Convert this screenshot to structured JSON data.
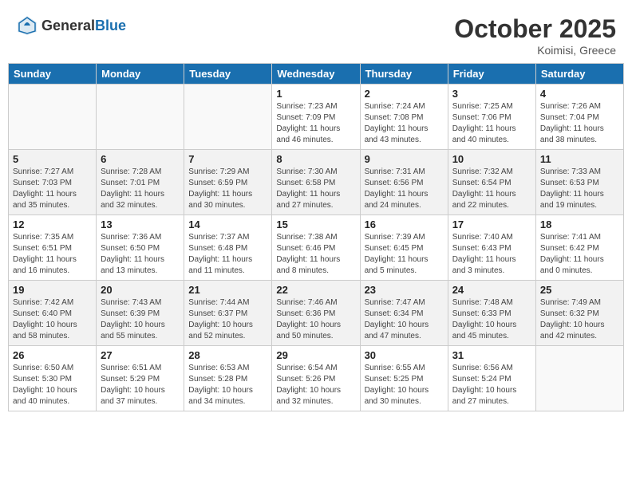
{
  "header": {
    "logo_general": "General",
    "logo_blue": "Blue",
    "month": "October 2025",
    "location": "Koimisi, Greece"
  },
  "weekdays": [
    "Sunday",
    "Monday",
    "Tuesday",
    "Wednesday",
    "Thursday",
    "Friday",
    "Saturday"
  ],
  "weeks": [
    [
      {
        "day": "",
        "info": ""
      },
      {
        "day": "",
        "info": ""
      },
      {
        "day": "",
        "info": ""
      },
      {
        "day": "1",
        "info": "Sunrise: 7:23 AM\nSunset: 7:09 PM\nDaylight: 11 hours and 46 minutes."
      },
      {
        "day": "2",
        "info": "Sunrise: 7:24 AM\nSunset: 7:08 PM\nDaylight: 11 hours and 43 minutes."
      },
      {
        "day": "3",
        "info": "Sunrise: 7:25 AM\nSunset: 7:06 PM\nDaylight: 11 hours and 40 minutes."
      },
      {
        "day": "4",
        "info": "Sunrise: 7:26 AM\nSunset: 7:04 PM\nDaylight: 11 hours and 38 minutes."
      }
    ],
    [
      {
        "day": "5",
        "info": "Sunrise: 7:27 AM\nSunset: 7:03 PM\nDaylight: 11 hours and 35 minutes."
      },
      {
        "day": "6",
        "info": "Sunrise: 7:28 AM\nSunset: 7:01 PM\nDaylight: 11 hours and 32 minutes."
      },
      {
        "day": "7",
        "info": "Sunrise: 7:29 AM\nSunset: 6:59 PM\nDaylight: 11 hours and 30 minutes."
      },
      {
        "day": "8",
        "info": "Sunrise: 7:30 AM\nSunset: 6:58 PM\nDaylight: 11 hours and 27 minutes."
      },
      {
        "day": "9",
        "info": "Sunrise: 7:31 AM\nSunset: 6:56 PM\nDaylight: 11 hours and 24 minutes."
      },
      {
        "day": "10",
        "info": "Sunrise: 7:32 AM\nSunset: 6:54 PM\nDaylight: 11 hours and 22 minutes."
      },
      {
        "day": "11",
        "info": "Sunrise: 7:33 AM\nSunset: 6:53 PM\nDaylight: 11 hours and 19 minutes."
      }
    ],
    [
      {
        "day": "12",
        "info": "Sunrise: 7:35 AM\nSunset: 6:51 PM\nDaylight: 11 hours and 16 minutes."
      },
      {
        "day": "13",
        "info": "Sunrise: 7:36 AM\nSunset: 6:50 PM\nDaylight: 11 hours and 13 minutes."
      },
      {
        "day": "14",
        "info": "Sunrise: 7:37 AM\nSunset: 6:48 PM\nDaylight: 11 hours and 11 minutes."
      },
      {
        "day": "15",
        "info": "Sunrise: 7:38 AM\nSunset: 6:46 PM\nDaylight: 11 hours and 8 minutes."
      },
      {
        "day": "16",
        "info": "Sunrise: 7:39 AM\nSunset: 6:45 PM\nDaylight: 11 hours and 5 minutes."
      },
      {
        "day": "17",
        "info": "Sunrise: 7:40 AM\nSunset: 6:43 PM\nDaylight: 11 hours and 3 minutes."
      },
      {
        "day": "18",
        "info": "Sunrise: 7:41 AM\nSunset: 6:42 PM\nDaylight: 11 hours and 0 minutes."
      }
    ],
    [
      {
        "day": "19",
        "info": "Sunrise: 7:42 AM\nSunset: 6:40 PM\nDaylight: 10 hours and 58 minutes."
      },
      {
        "day": "20",
        "info": "Sunrise: 7:43 AM\nSunset: 6:39 PM\nDaylight: 10 hours and 55 minutes."
      },
      {
        "day": "21",
        "info": "Sunrise: 7:44 AM\nSunset: 6:37 PM\nDaylight: 10 hours and 52 minutes."
      },
      {
        "day": "22",
        "info": "Sunrise: 7:46 AM\nSunset: 6:36 PM\nDaylight: 10 hours and 50 minutes."
      },
      {
        "day": "23",
        "info": "Sunrise: 7:47 AM\nSunset: 6:34 PM\nDaylight: 10 hours and 47 minutes."
      },
      {
        "day": "24",
        "info": "Sunrise: 7:48 AM\nSunset: 6:33 PM\nDaylight: 10 hours and 45 minutes."
      },
      {
        "day": "25",
        "info": "Sunrise: 7:49 AM\nSunset: 6:32 PM\nDaylight: 10 hours and 42 minutes."
      }
    ],
    [
      {
        "day": "26",
        "info": "Sunrise: 6:50 AM\nSunset: 5:30 PM\nDaylight: 10 hours and 40 minutes."
      },
      {
        "day": "27",
        "info": "Sunrise: 6:51 AM\nSunset: 5:29 PM\nDaylight: 10 hours and 37 minutes."
      },
      {
        "day": "28",
        "info": "Sunrise: 6:53 AM\nSunset: 5:28 PM\nDaylight: 10 hours and 34 minutes."
      },
      {
        "day": "29",
        "info": "Sunrise: 6:54 AM\nSunset: 5:26 PM\nDaylight: 10 hours and 32 minutes."
      },
      {
        "day": "30",
        "info": "Sunrise: 6:55 AM\nSunset: 5:25 PM\nDaylight: 10 hours and 30 minutes."
      },
      {
        "day": "31",
        "info": "Sunrise: 6:56 AM\nSunset: 5:24 PM\nDaylight: 10 hours and 27 minutes."
      },
      {
        "day": "",
        "info": ""
      }
    ]
  ]
}
